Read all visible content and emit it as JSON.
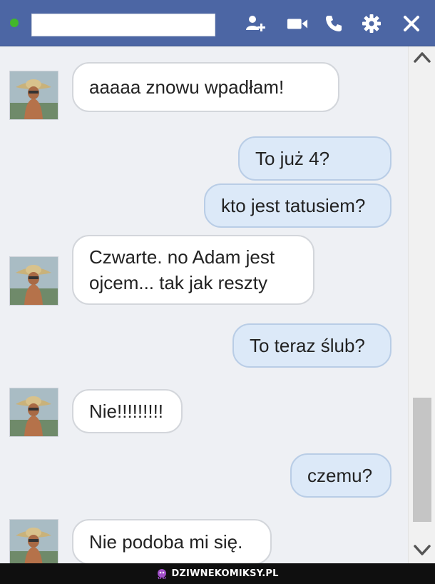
{
  "header": {
    "background": "#4c66a4",
    "status_color": "#42b72a",
    "icons": [
      "add-friend-icon",
      "video-camera-icon",
      "phone-icon",
      "gear-icon",
      "close-icon"
    ]
  },
  "messages": [
    {
      "sender": "them",
      "text": "aaaaa znowu wpadłam!"
    },
    {
      "sender": "me",
      "text": "To już 4?"
    },
    {
      "sender": "me",
      "text": "kto jest tatusiem?"
    },
    {
      "sender": "them",
      "text": "Czwarte. no Adam jest\nojcem... tak jak reszty"
    },
    {
      "sender": "me",
      "text": "To teraz ślub?"
    },
    {
      "sender": "them",
      "text": "Nie!!!!!!!!!"
    },
    {
      "sender": "me",
      "text": "czemu?"
    },
    {
      "sender": "them",
      "text": "Nie podoba mi się."
    }
  ],
  "footer": {
    "site": "DZIWNEKOMIKSY.PL"
  }
}
